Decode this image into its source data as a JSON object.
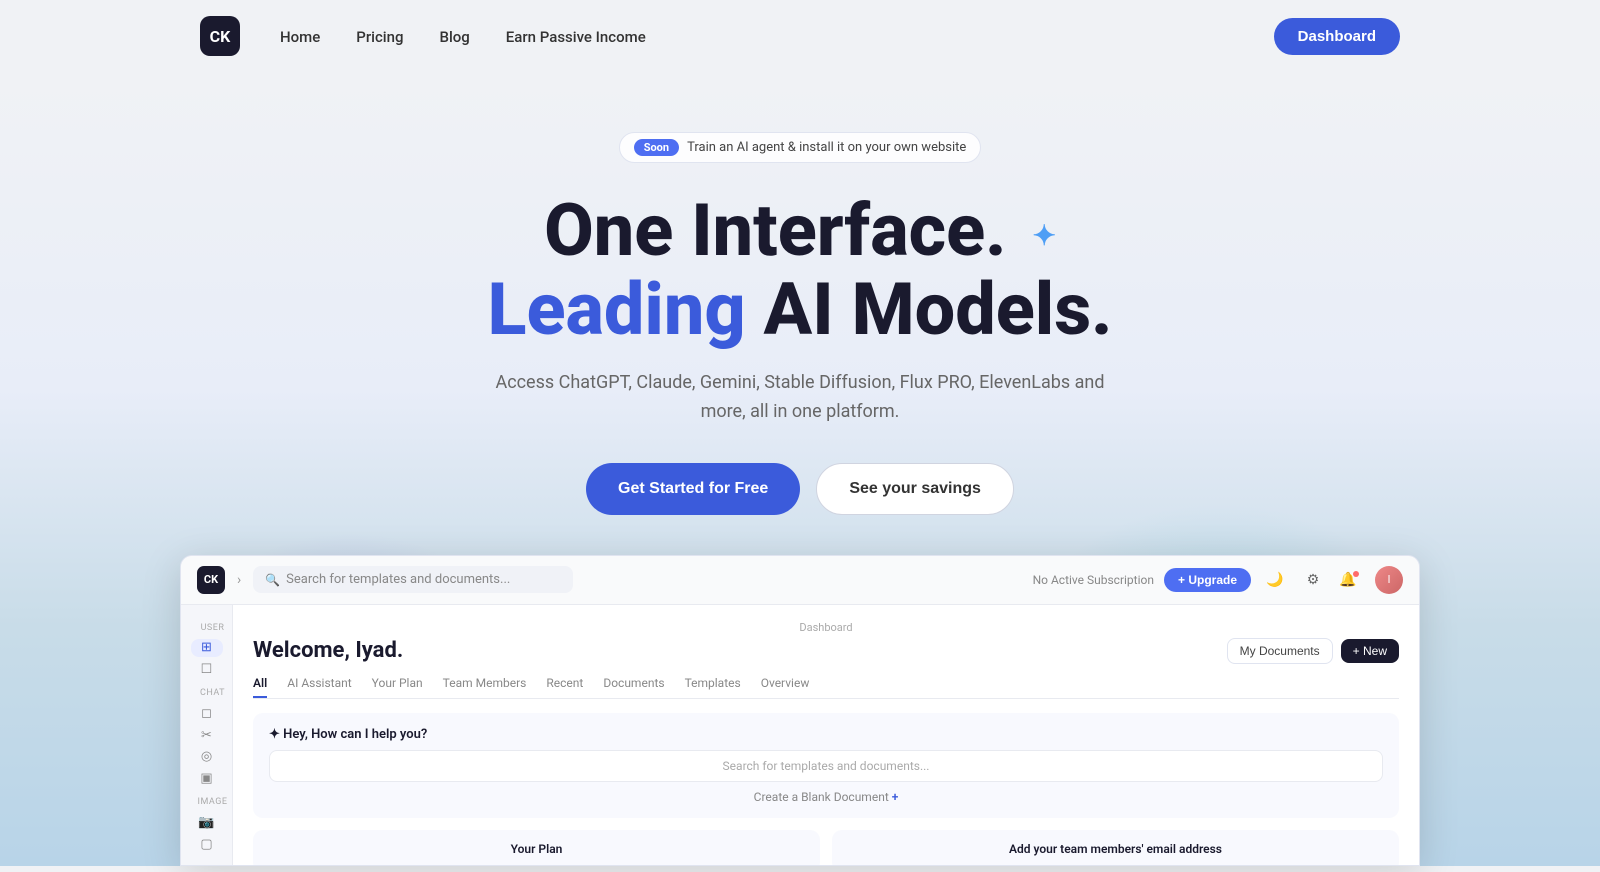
{
  "nav": {
    "logo_text": "CK",
    "links": [
      {
        "label": "Home",
        "id": "home"
      },
      {
        "label": "Pricing",
        "id": "pricing"
      },
      {
        "label": "Blog",
        "id": "blog"
      },
      {
        "label": "Earn Passive Income",
        "id": "earn"
      }
    ],
    "dashboard_btn": "Dashboard"
  },
  "hero": {
    "badge_label": "Soon",
    "badge_text": "Train an AI agent & install it on your own website",
    "title_line1": "One Interface.",
    "title_leading": "Leading",
    "title_ai": " AI Models.",
    "subtitle": "Access ChatGPT, Claude, Gemini, Stable Diffusion, Flux PRO, ElevenLabs and\nmore, all in one platform.",
    "btn_primary": "Get Started for Free",
    "btn_secondary": "See your savings"
  },
  "dashboard": {
    "search_placeholder": "Search for templates and documents...",
    "no_sub_text": "No Active Subscription",
    "upgrade_btn": "+ Upgrade",
    "breadcrumb": "Dashboard",
    "welcome": "Welcome, Iyad.",
    "my_docs_btn": "My Documents",
    "new_btn": "+ New",
    "tabs": [
      "All",
      "AI Assistant",
      "Your Plan",
      "Team Members",
      "Recent",
      "Documents",
      "Templates",
      "Overview"
    ],
    "active_tab": "All",
    "ai_greeting": "✦ Hey, How can I help you?",
    "ai_search_placeholder": "Search for templates and documents...",
    "create_blank": "Create a Blank Document",
    "create_blank_plus": " +",
    "your_plan_title": "Your Plan",
    "team_card_title": "Add your team members' email address"
  },
  "sidebar": {
    "user_label": "USER",
    "chat_label": "CHAT",
    "image_label": "IMAGE",
    "icons": [
      "⊞",
      "☐",
      "◎",
      "☐",
      "◎",
      "☐",
      "◎"
    ]
  },
  "colors": {
    "primary": "#3b5bdb",
    "dark": "#1a1a2e",
    "accent_blue": "#4e9ef5"
  }
}
